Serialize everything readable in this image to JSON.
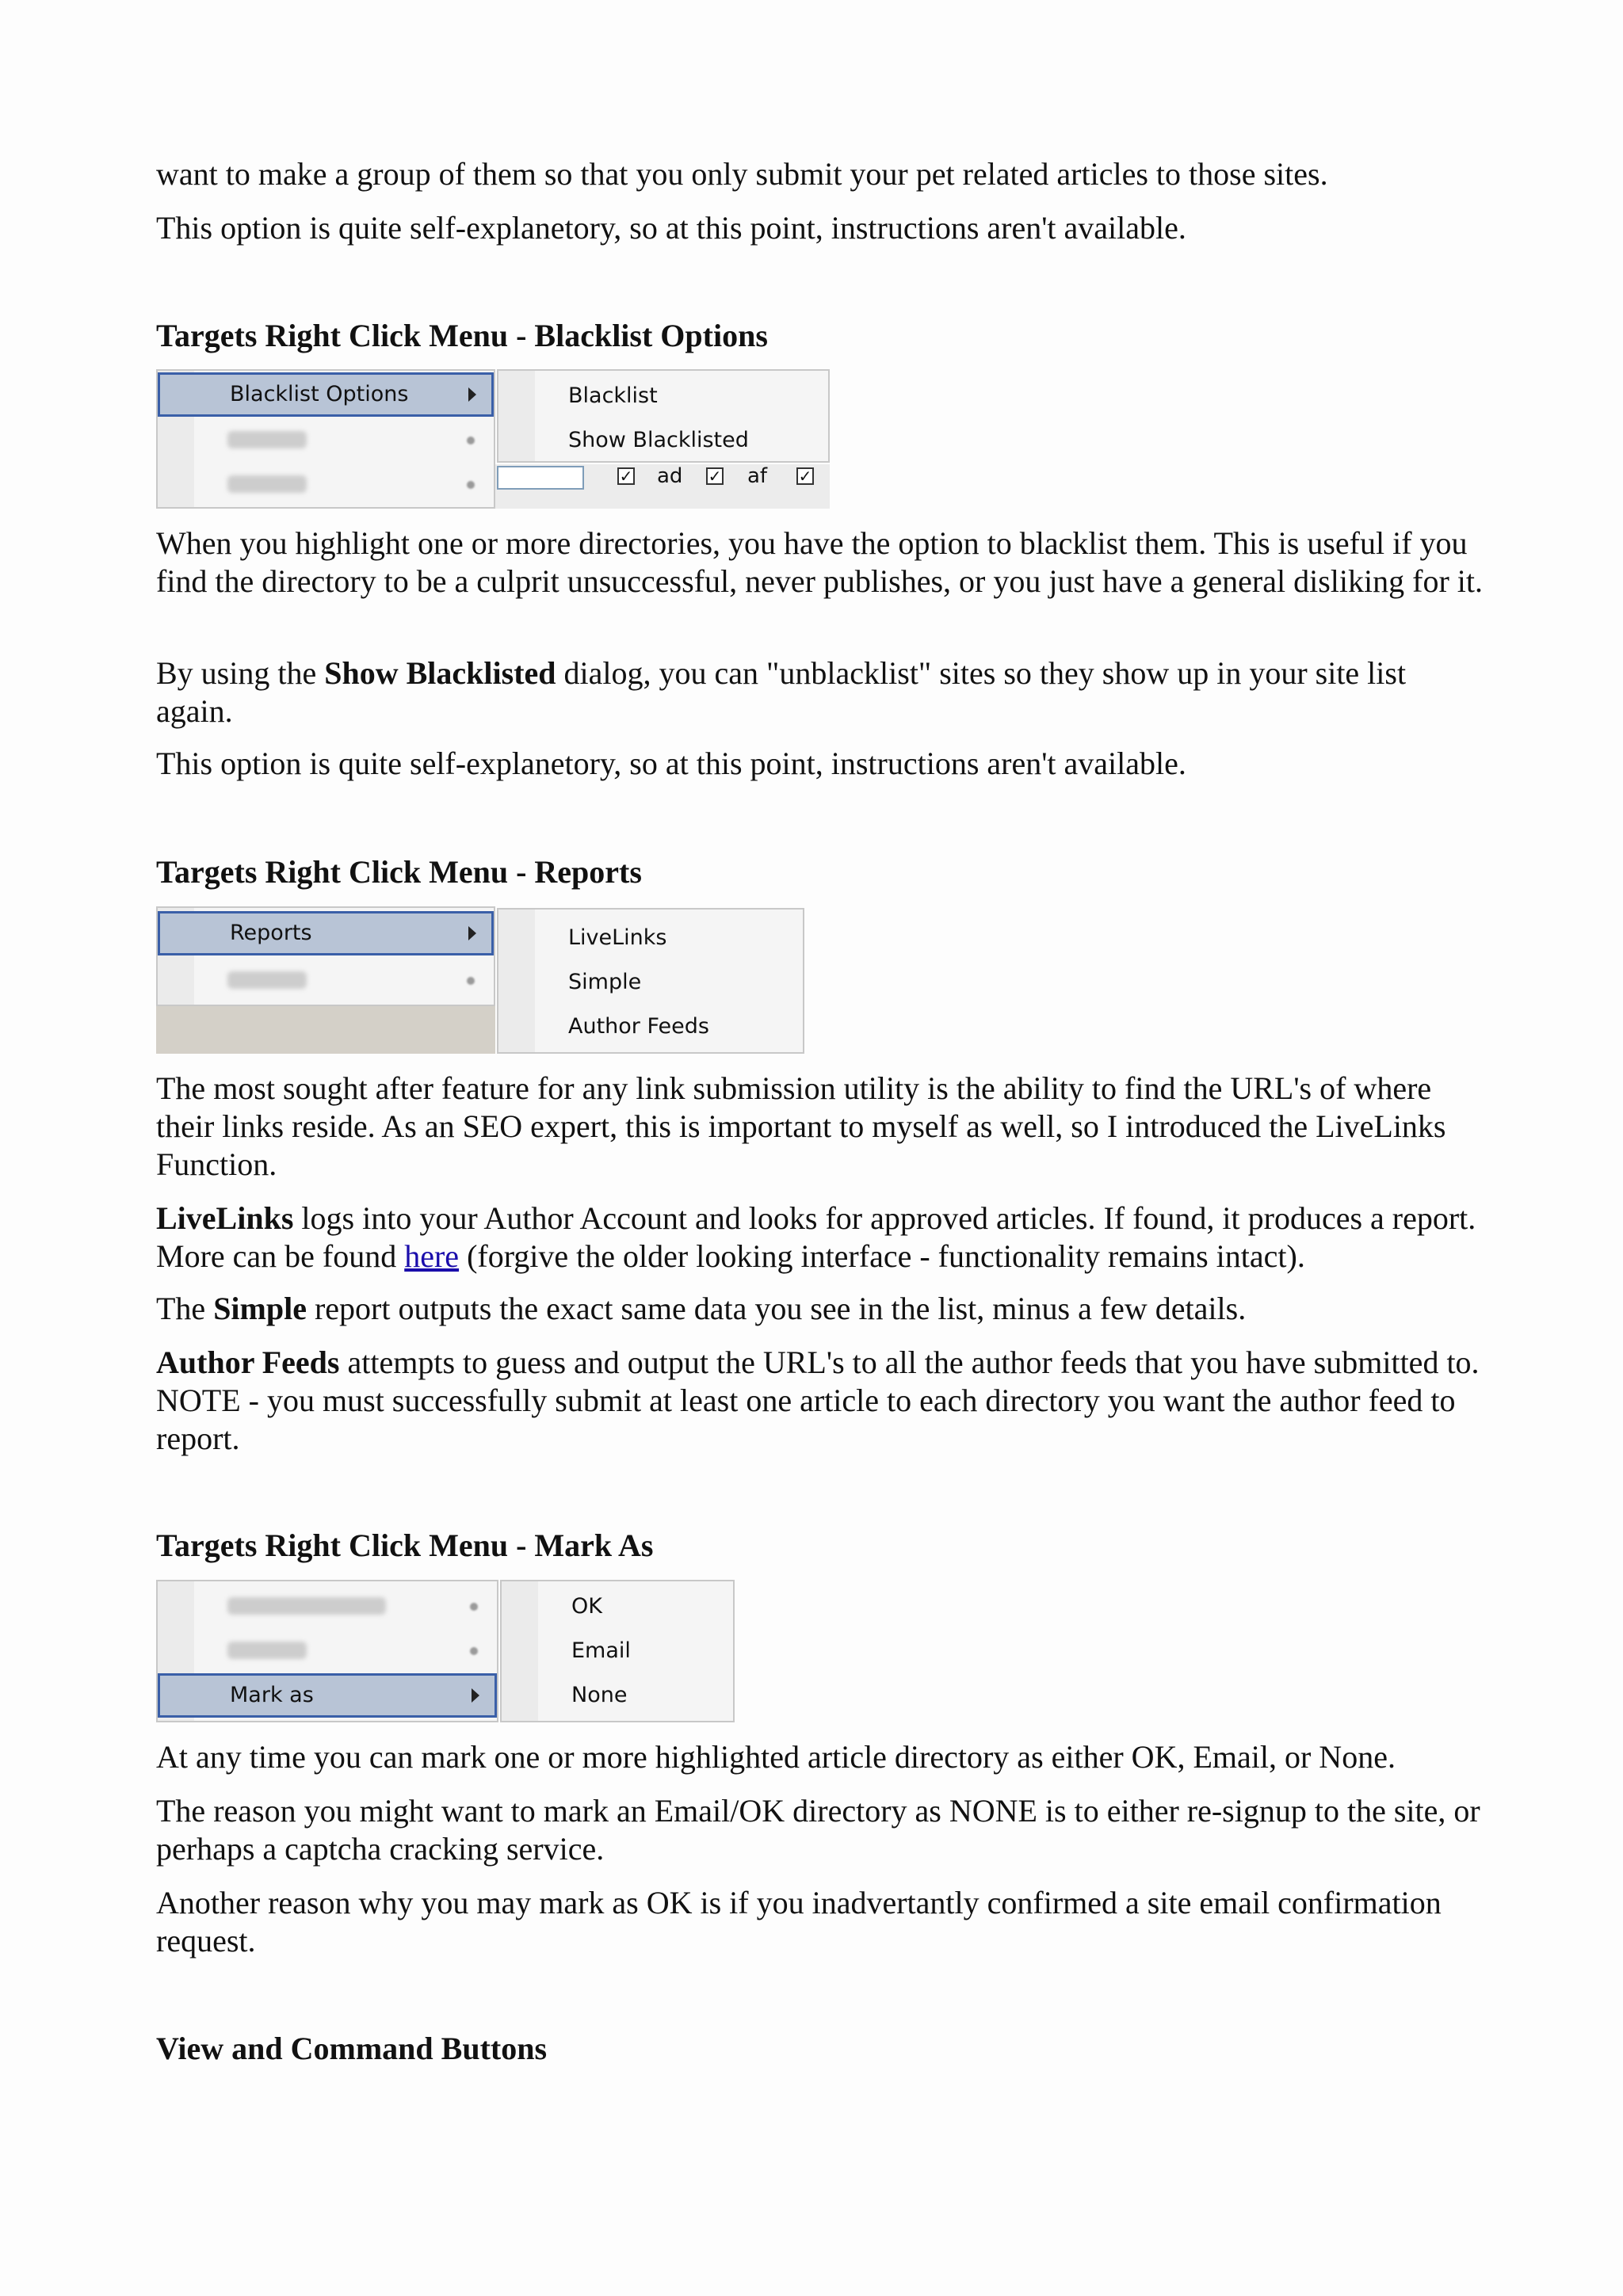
{
  "intro": {
    "p1": "want to make a group of them so that you only submit your pet related articles to those sites.",
    "p2": "This option is quite self-explanetory, so at this point, instructions aren't available."
  },
  "blacklist": {
    "heading": "Targets Right Click Menu - Blacklist Options",
    "menu": {
      "selected": "Blacklist Options",
      "blurred": [
        "Reports",
        "Mark as"
      ]
    },
    "submenu": [
      "Blacklist",
      "Show Blacklisted"
    ],
    "checkboxes": [
      "ad",
      "af"
    ],
    "p1": "When you highlight one or more directories, you have the option to blacklist them. This is useful if you find the directory to be a culprit unsuccessful, never publishes, or you just have a general disliking for it.",
    "p2_before": "By using the ",
    "p2_bold": "Show Blacklisted",
    "p2_after": " dialog, you can \"unblacklist\" sites so they show up in your site list again.",
    "p3": "This option is quite self-explanetory, so at this point, instructions aren't available."
  },
  "reports": {
    "heading": "Targets Right Click Menu - Reports",
    "menu": {
      "selected": "Reports",
      "blurred": [
        "Mark as"
      ]
    },
    "submenu": [
      "LiveLinks",
      "Simple",
      "Author Feeds"
    ],
    "p1": "The most sought after feature for any link submission utility is the ability to find the URL's of where their links reside. As an SEO expert, this is important to myself as well, so I introduced the LiveLinks Function.",
    "p2_bold": "LiveLinks",
    "p2_mid": " logs into your Author Account and looks for approved articles. If found, it produces a report. More can be found ",
    "p2_link": "here",
    "p2_after": " (forgive the older looking interface - functionality remains intact).",
    "p3_before": "The ",
    "p3_bold": "Simple",
    "p3_after": " report outputs the exact same data you see in the list, minus a few details.",
    "p4_bold": "Author Feeds",
    "p4_after": " attempts to guess and output the URL's to all the author feeds that you have submitted to. NOTE - you must successfully submit at least one article to each directory you want the author feed to report."
  },
  "markas": {
    "heading": "Targets Right Click Menu - Mark As",
    "menu": {
      "selected": "Mark as",
      "blurred": [
        "Blacklist Options",
        "Reports"
      ]
    },
    "submenu": [
      "OK",
      "Email",
      "None"
    ],
    "p1": "At any time you can mark one or more highlighted article directory as either OK, Email, or None.",
    "p2": "The reason you might want to mark an Email/OK directory as NONE is to either re-signup to the site, or perhaps a captcha cracking service.",
    "p3": "Another reason why you may mark as OK is if you inadvertantly confirmed a site email confirmation request."
  },
  "view": {
    "heading": "View and Command Buttons"
  }
}
